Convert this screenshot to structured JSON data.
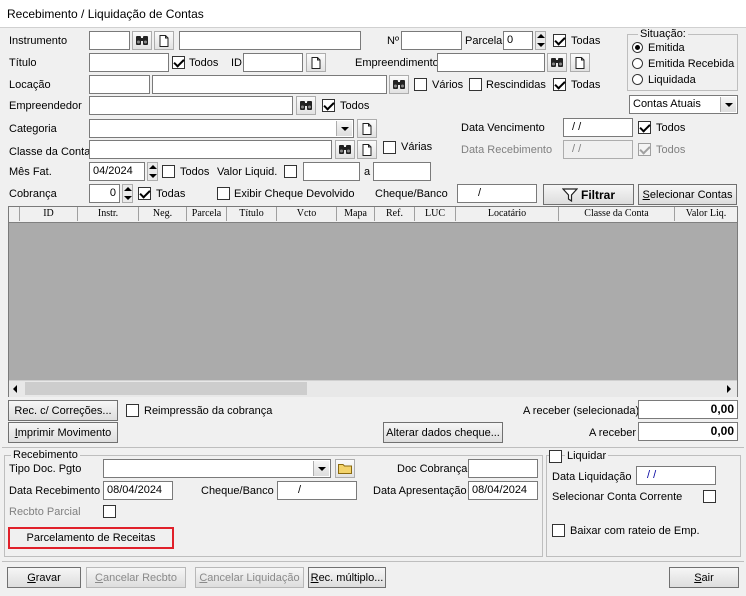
{
  "window": {
    "title": "Recebimento / Liquidação de Contas"
  },
  "filters": {
    "instrumento_label": "Instrumento",
    "num_label": "Nº",
    "parcela_label": "Parcela",
    "parcela_value": "0",
    "todas_label": "Todas",
    "titulo_label": "Título",
    "todos_label": "Todos",
    "id_label": "ID",
    "empreendimento_label": "Empreendimento",
    "locacao_label": "Locação",
    "varios_label": "Vários",
    "rescindidas_label": "Rescindidas",
    "empreendedor_label": "Empreendedor",
    "categoria_label": "Categoria",
    "classe_label": "Classe da Conta",
    "varias_label": "Várias",
    "mesfat_label": "Mês Fat.",
    "mesfat_value": "04/2024",
    "valorliquid_label": "Valor Liquid.",
    "a_label": "a",
    "cobranca_label": "Cobrança",
    "cobranca_value": "0",
    "exibir_cheque_label": "Exibir Cheque Devolvido",
    "cheque_banco_label": "Cheque/Banco",
    "cheque_banco_value": "/",
    "data_venc_label": "Data Vencimento",
    "data_venc_value": "/ /",
    "data_receb_label": "Data Recebimento",
    "data_receb_value": "/ /",
    "filtrar_label": "Filtrar",
    "selecionar_label": "Selecionar Contas",
    "contas_atuais": "Contas Atuais"
  },
  "situacao": {
    "title": "Situação:",
    "options": [
      "Emitida",
      "Emitida Recebida",
      "Liquidada"
    ],
    "selected": "Emitida"
  },
  "grid": {
    "columns": [
      "ID",
      "Instr.",
      "Neg.",
      "Parcela",
      "Título",
      "Vcto",
      "Mapa",
      "Ref.",
      "LUC",
      "Locatário",
      "Classe da Conta",
      "Valor Liq."
    ]
  },
  "actions": {
    "rec_correcoes": "Rec. c/ Correções...",
    "reimpressao": "Reimpressão da cobrança",
    "imprimir": "Imprimir Movimento",
    "alterar_cheque": "Alterar dados cheque...",
    "a_receber_sel_label": "A receber (selecionada)",
    "a_receber_sel_value": "0,00",
    "a_receber_label": "A receber",
    "a_receber_value": "0,00"
  },
  "recebimento": {
    "title": "Recebimento",
    "tipo_doc_label": "Tipo Doc. Pgto",
    "doc_cobranca_label": "Doc Cobrança",
    "data_receb_label": "Data Recebimento",
    "data_receb_value": "08/04/2024",
    "cheque_banco_label": "Cheque/Banco",
    "cheque_banco_value": "/",
    "data_apres_label": "Data Apresentação",
    "data_apres_value": "08/04/2024",
    "recbto_parcial_label": "Recbto Parcial",
    "parcelamento_label": "Parcelamento de Receitas"
  },
  "liquidar": {
    "title": "Liquidar",
    "data_liq_label": "Data Liquidação",
    "data_liq_value": "/ /",
    "sel_conta_label": "Selecionar Conta Corrente",
    "baixar_label": "Baixar com rateio de Emp."
  },
  "footer": {
    "gravar": "Gravar",
    "cancelar_recbto": "Cancelar Recbto",
    "cancelar_liq": "Cancelar Liquidação",
    "rec_multiplo": "Rec. múltiplo...",
    "sair": "Sair"
  },
  "colors": {
    "highlight_border": "#E0202A",
    "grid_bg": "#ABABAB",
    "title_bg": "#FFFFFF"
  }
}
